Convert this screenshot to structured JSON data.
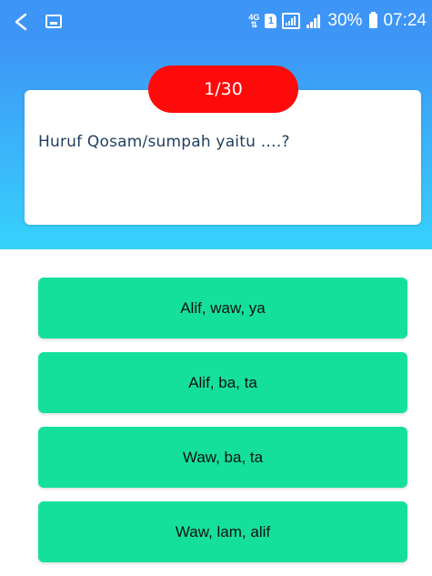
{
  "status_bar": {
    "network": "4G",
    "sim": "1",
    "battery_percent": "30%",
    "time": "07:24"
  },
  "quiz": {
    "counter": "1/30",
    "question": "Huruf Qosam/sumpah yaitu ….?"
  },
  "answers": [
    {
      "label": "Alif, waw, ya"
    },
    {
      "label": "Alif, ba, ta"
    },
    {
      "label": "Waw, ba, ta"
    },
    {
      "label": "Waw, lam, alif"
    }
  ],
  "colors": {
    "status_bar": "#3d95f6",
    "header_top": "#3d95f6",
    "header_bottom": "#36d2fb",
    "counter_pill": "#ff0a0a",
    "answer_button": "#14e09c",
    "question_text": "#1f3f5f"
  },
  "icons": [
    "back-arrow-icon",
    "gallery-icon",
    "sim-icon",
    "signal-icon",
    "battery-icon"
  ]
}
